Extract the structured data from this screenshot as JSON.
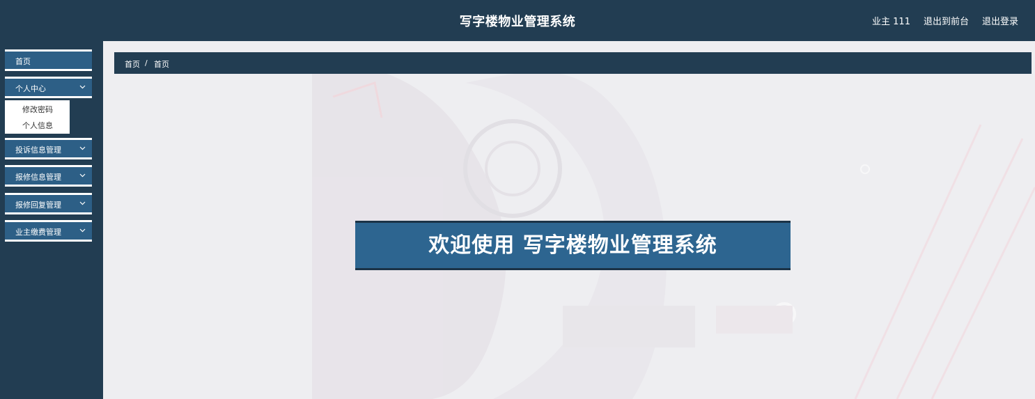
{
  "header": {
    "title": "写字楼物业管理系统",
    "user_label": "业主 111",
    "to_front_label": "退出到前台",
    "logout_label": "退出登录"
  },
  "sidebar": {
    "items": [
      {
        "label": "首页",
        "expandable": false
      },
      {
        "label": "个人中心",
        "expandable": true,
        "expanded": true,
        "children": [
          {
            "label": "修改密码"
          },
          {
            "label": "个人信息"
          }
        ]
      },
      {
        "label": "投诉信息管理",
        "expandable": true
      },
      {
        "label": "报修信息管理",
        "expandable": true
      },
      {
        "label": "报修回复管理",
        "expandable": true
      },
      {
        "label": "业主缴费管理",
        "expandable": true
      }
    ]
  },
  "breadcrumb": {
    "root": "首页",
    "separator": "/",
    "current": "首页"
  },
  "welcome": {
    "text": "欢迎使用 写字楼物业管理系统"
  },
  "colors": {
    "header_bg": "#223d52",
    "menu_bg": "#2d5f86",
    "welcome_bg": "#2d6590",
    "content_bg": "#efeff1"
  },
  "icons": {
    "menu_expand": "chevron-down-icon"
  }
}
